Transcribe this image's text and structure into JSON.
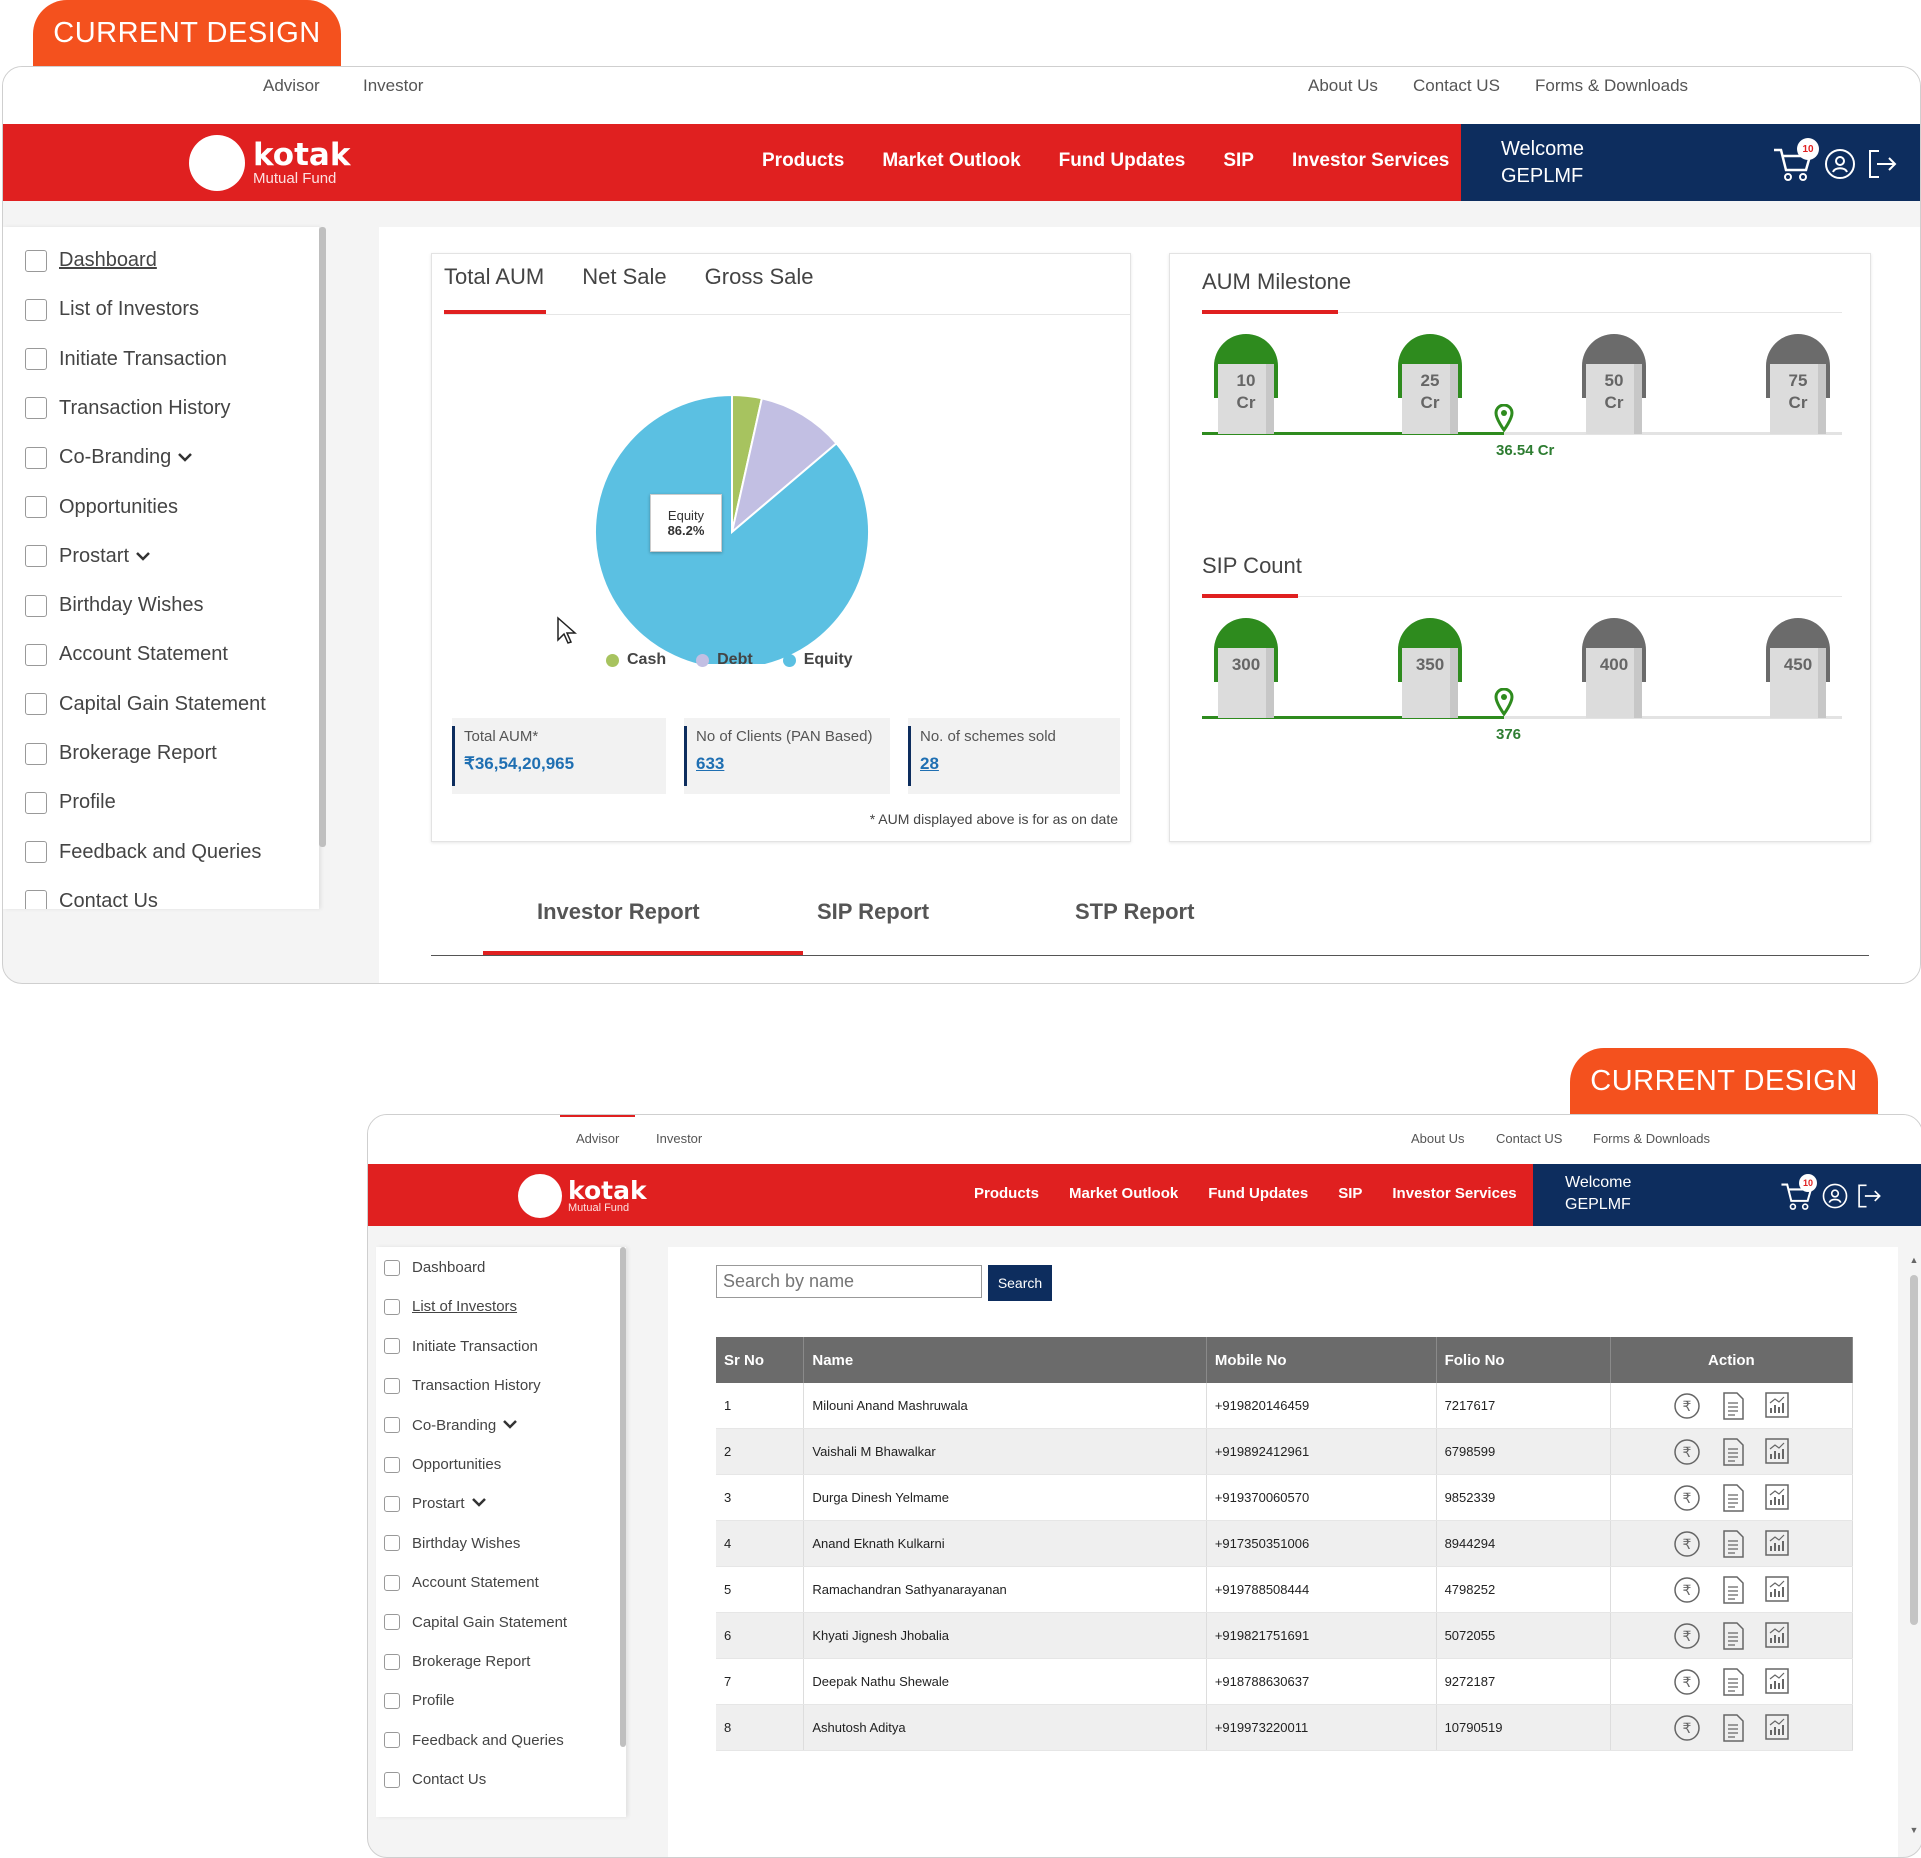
{
  "tag_label": "CURRENT DESIGN",
  "colors": {
    "accent": "#f4511e",
    "brand_red": "#e02020",
    "navy": "#0d2d5e",
    "equity": "#5bc0e2",
    "debt": "#c2bfe3",
    "cash": "#a7c35f",
    "milestone_done": "#2e8b1e",
    "milestone_pending": "#6b6b6b"
  },
  "top_links": {
    "advisor": "Advisor",
    "investor": "Investor",
    "about": "About Us",
    "contact": "Contact US",
    "forms": "Forms & Downloads"
  },
  "brand": {
    "name": "kotak",
    "sub": "Mutual Fund"
  },
  "nav_items": [
    "Products",
    "Market Outlook",
    "Fund Updates",
    "SIP",
    "Investor Services"
  ],
  "welcome": {
    "line1": "Welcome",
    "line2": "GEPLMF",
    "cart_count": "10"
  },
  "sidebar": [
    {
      "label": "Dashboard",
      "icon": "dashboard-icon",
      "dropdown": false
    },
    {
      "label": "List of Investors",
      "icon": "investors-icon",
      "dropdown": false
    },
    {
      "label": "Initiate Transaction",
      "icon": "transaction-icon",
      "dropdown": false
    },
    {
      "label": "Transaction History",
      "icon": "history-icon",
      "dropdown": false
    },
    {
      "label": "Co-Branding",
      "icon": "handshake-icon",
      "dropdown": true
    },
    {
      "label": "Opportunities",
      "icon": "target-icon",
      "dropdown": false
    },
    {
      "label": "Prostart",
      "icon": "prostart-icon",
      "dropdown": true
    },
    {
      "label": "Birthday Wishes",
      "icon": "gift-icon",
      "dropdown": false
    },
    {
      "label": "Account Statement",
      "icon": "statement-icon",
      "dropdown": false
    },
    {
      "label": "Capital Gain Statement",
      "icon": "capital-gain-icon",
      "dropdown": false
    },
    {
      "label": "Brokerage Report",
      "icon": "brokerage-icon",
      "dropdown": false
    },
    {
      "label": "Profile",
      "icon": "profile-icon",
      "dropdown": false
    },
    {
      "label": "Feedback and Queries",
      "icon": "feedback-icon",
      "dropdown": false
    },
    {
      "label": "Contact Us",
      "icon": "phone-icon",
      "dropdown": false
    }
  ],
  "aum_tabs": [
    "Total AUM",
    "Net Sale",
    "Gross Sale"
  ],
  "chart_data": {
    "type": "pie",
    "slices": [
      {
        "label": "Cash",
        "value": 3.5,
        "color": "#a7c35f"
      },
      {
        "label": "Debt",
        "value": 10.3,
        "color": "#c2bfe3"
      },
      {
        "label": "Equity",
        "value": 86.2,
        "color": "#5bc0e2"
      }
    ],
    "tooltip_label": "Equity",
    "tooltip_value": "86.2%",
    "legend": [
      "Cash",
      "Debt",
      "Equity"
    ],
    "legend_position": "bottom"
  },
  "stats": [
    {
      "label": "Total AUM*",
      "value": "₹36,54,20,965"
    },
    {
      "label": "No of Clients (PAN Based)",
      "value": "633"
    },
    {
      "label": "No. of schemes sold",
      "value": "28"
    }
  ],
  "aum_note": "* AUM displayed above is for as on date",
  "aum_milestone": {
    "title": "AUM Milestone",
    "stones": [
      {
        "top": "10",
        "bottom": "Cr",
        "done": true
      },
      {
        "top": "25",
        "bottom": "Cr",
        "done": true
      },
      {
        "top": "50",
        "bottom": "Cr",
        "done": false
      },
      {
        "top": "75",
        "bottom": "Cr",
        "done": false
      }
    ],
    "current": "36.54 Cr"
  },
  "sip_count": {
    "title": "SIP Count",
    "stones": [
      {
        "top": "300",
        "done": true
      },
      {
        "top": "350",
        "done": true
      },
      {
        "top": "400",
        "done": false
      },
      {
        "top": "450",
        "done": false
      }
    ],
    "current": "376"
  },
  "report_tabs": [
    "Investor Report",
    "SIP Report",
    "STP Report"
  ],
  "search": {
    "placeholder": "Search by name",
    "button": "Search"
  },
  "table": {
    "headers": [
      "Sr No",
      "Name",
      "Mobile No",
      "Folio No",
      "Action"
    ],
    "rows": [
      [
        "1",
        "Milouni Anand Mashruwala",
        "+919820146459",
        "7217617"
      ],
      [
        "2",
        "Vaishali M Bhawalkar",
        "+919892412961",
        "6798599"
      ],
      [
        "3",
        "Durga Dinesh Yelmame",
        "+919370060570",
        "9852339"
      ],
      [
        "4",
        "Anand Eknath Kulkarni",
        "+917350351006",
        "8944294"
      ],
      [
        "5",
        "Ramachandran Sathyanarayanan",
        "+919788508444",
        "4798252"
      ],
      [
        "6",
        "Khyati Jignesh Jhobalia",
        "+919821751691",
        "5072055"
      ],
      [
        "7",
        "Deepak Nathu Shewale",
        "+918788630637",
        "9272187"
      ],
      [
        "8",
        "Ashutosh Aditya",
        "+919973220011",
        "10790519"
      ]
    ]
  }
}
